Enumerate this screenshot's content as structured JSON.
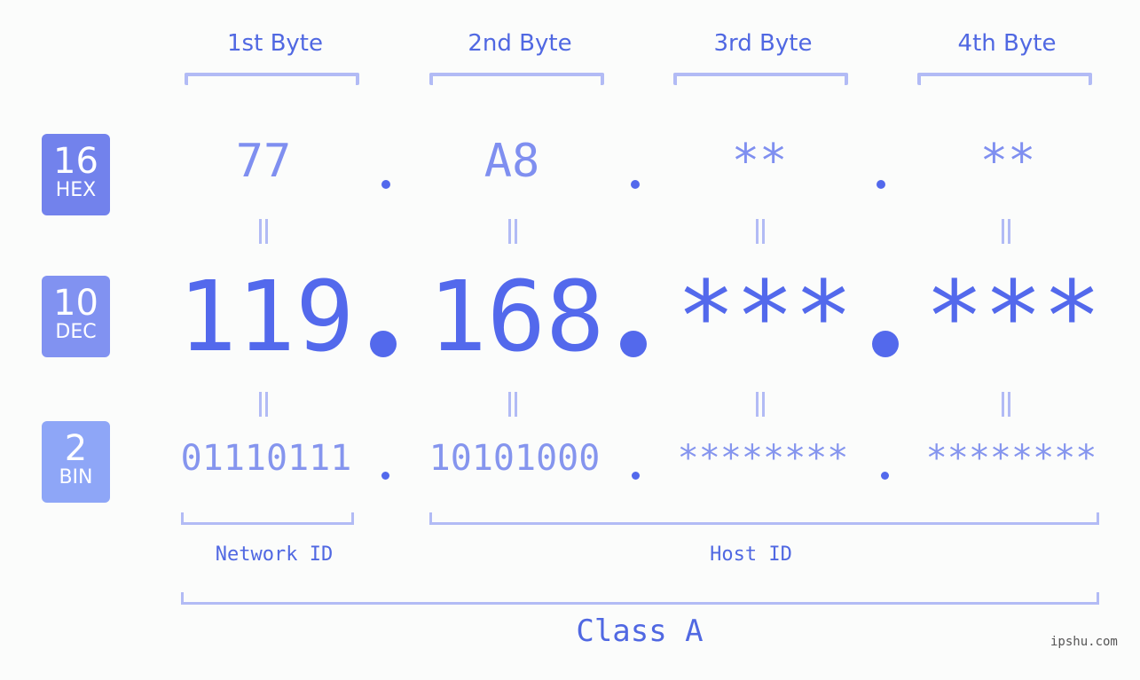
{
  "headers": [
    "1st Byte",
    "2nd Byte",
    "3rd Byte",
    "4th Byte"
  ],
  "badges": {
    "hex": {
      "num": "16",
      "label": "HEX",
      "color": "#7282ec"
    },
    "dec": {
      "num": "10",
      "label": "DEC",
      "color": "#8192f1"
    },
    "bin": {
      "num": "2",
      "label": "BIN",
      "color": "#8ea6f7"
    }
  },
  "hex_values": [
    "77",
    "A8",
    "**",
    "**"
  ],
  "dec_values": [
    "119",
    "168",
    "***",
    "***"
  ],
  "bin_values": [
    "01110111",
    "10101000",
    "********",
    "********"
  ],
  "separator": ".",
  "equals_symbol": "=",
  "segments": {
    "network": "Network ID",
    "host": "Host ID"
  },
  "class_label": "Class A",
  "watermark": "ipshu.com",
  "colors": {
    "accent": "#5369ec",
    "bracket": "#b2bbf5",
    "background": "#fbfcfb"
  }
}
